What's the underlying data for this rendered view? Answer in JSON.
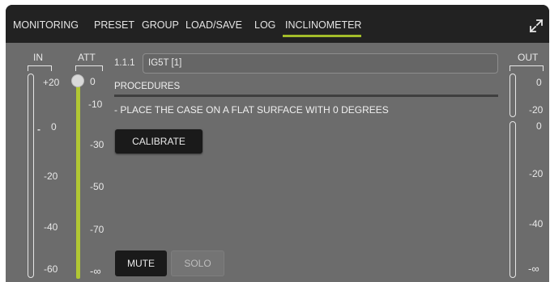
{
  "tabs": [
    {
      "label": "MONITORING",
      "active": false
    },
    {
      "label": "PRESET",
      "active": false
    },
    {
      "label": "GROUP",
      "active": false
    },
    {
      "label": "LOAD/SAVE",
      "active": false
    },
    {
      "label": "LOG",
      "active": false
    },
    {
      "label": "INCLINOMETER",
      "active": true
    }
  ],
  "expand_icon": "expand-arrows-icon",
  "in_meter": {
    "label": "IN",
    "scale": [
      "+20",
      "0",
      "-20",
      "-40",
      "-60"
    ]
  },
  "att": {
    "label": "ATT",
    "scale_a": [
      "0",
      "-30",
      "-70"
    ],
    "scale_b": [
      "-10",
      "-50",
      "-∞"
    ]
  },
  "out_meter": {
    "label": "OUT",
    "scale_top": [
      "0",
      "-20"
    ],
    "scale": [
      "0",
      "-20",
      "-40",
      "-∞"
    ]
  },
  "device": {
    "id": "1.1.1",
    "name": "IG5T [1]"
  },
  "procedures": {
    "title": "PROCEDURES",
    "text": "- PLACE THE CASE ON A FLAT SURFACE WITH 0 DEGREES"
  },
  "buttons": {
    "calibrate": "CALIBRATE",
    "mute": "MUTE",
    "solo": "SOLO"
  },
  "colors": {
    "accent": "#a3bd2a",
    "fader": "#b1c733",
    "panel": "#6c6c6c",
    "topbar": "#222222"
  }
}
